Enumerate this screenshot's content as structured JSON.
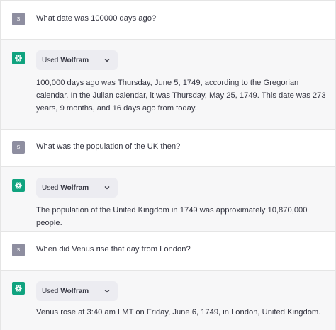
{
  "conversation": [
    {
      "role": "user",
      "avatar_letter": "S",
      "text": "What date was 100000 days ago?"
    },
    {
      "role": "assistant",
      "tool": {
        "prefix": "Used",
        "name": "Wolfram"
      },
      "text": "100,000 days ago was Thursday, June 5, 1749, according to the Gregorian calendar. In the Julian calendar, it was Thursday, May 25, 1749. This date was 273 years, 9 months, and 16 days ago from today."
    },
    {
      "role": "user",
      "avatar_letter": "S",
      "text": "What was the population of the UK then?"
    },
    {
      "role": "assistant",
      "tool": {
        "prefix": "Used",
        "name": "Wolfram"
      },
      "text": "The population of the United Kingdom in 1749 was approximately 10,870,000 people."
    },
    {
      "role": "user",
      "avatar_letter": "S",
      "text": "When did Venus rise that day from London?"
    },
    {
      "role": "assistant",
      "tool": {
        "prefix": "Used",
        "name": "Wolfram"
      },
      "text": "Venus rose at 3:40 am LMT on Friday, June 6, 1749, in London, United Kingdom."
    }
  ],
  "colors": {
    "assistant_avatar": "#10a37f",
    "user_avatar": "#8e8ea0",
    "assistant_bg": "#f7f7f8",
    "pill_bg": "#ececf1"
  },
  "icons": {
    "assistant_avatar": "openai-logo-icon",
    "tool_toggle": "chevron-down-icon"
  }
}
